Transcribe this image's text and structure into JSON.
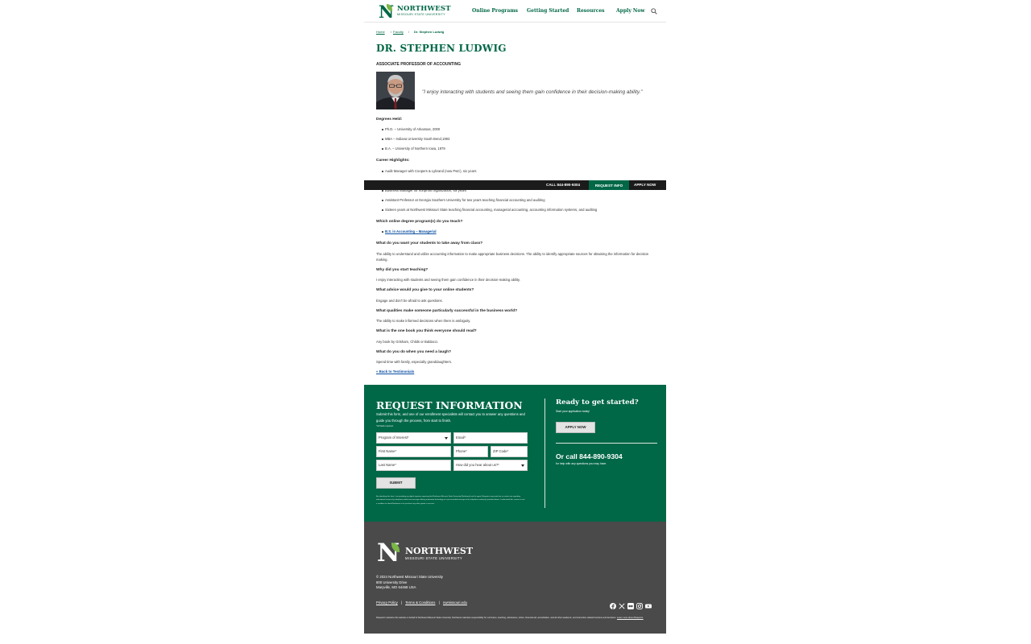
{
  "header": {
    "logo_title": "NORTHWEST",
    "logo_subtitle": "MISSOURI STATE UNIVERSITY",
    "nav": [
      "Online Programs",
      "Getting Started",
      "Resources",
      "Apply Now"
    ],
    "search_icon": "search-icon"
  },
  "breadcrumb": {
    "home": "Home",
    "sep": "/",
    "faculty": "Faculty",
    "current": "Dr. Stephen Ludwig"
  },
  "profile": {
    "name": "DR. STEPHEN LUDWIG",
    "title": "ASSOCIATE PROFESSOR OF ACCOUNTING",
    "quote": "\"I enjoy interacting with students and seeing them gain confidence in their decision-making ability.\""
  },
  "degrees": {
    "heading": "Degrees Held:",
    "items": [
      "Ph.D. – University of Arkansas, 2000",
      "MBA – Indiana University South Bend,1993",
      "B.A. – University of Northern Iowa, 1979"
    ]
  },
  "career": {
    "heading": "Career Highlights:",
    "items": [
      "Audit Manager with Coopers & Lybrand (now PwC), six years",
      "Business Manager for nonprofit organization, six years",
      "Assistant Professor at Georgia Southern University for two years teaching financial accounting and auditing",
      "Sixteen years at Northwest Missouri State teaching financial accounting, managerial accounting, accounting information systems, and auditing"
    ]
  },
  "qa": [
    {
      "q": "Which online degree program(s) do you teach?",
      "link": "B.S. in Accounting – Managerial"
    },
    {
      "q": "What do you want your students to take away from class?",
      "a": "The ability to understand and utilize accounting information to make appropriate business decisions. The ability to identify appropriate sources for obtaining the information for decision making."
    },
    {
      "q": "Why did you start teaching?",
      "a": "I enjoy interacting with students and seeing them gain confidence in their decision-making ability."
    },
    {
      "q": "What advice would you give to your online students?",
      "a": "Engage and don't be afraid to ask questions."
    },
    {
      "q": "What qualities make someone particularly successful in the business world?",
      "a": "The ability to make informed decisions when there is ambiguity."
    },
    {
      "q": "What is the one book you think everyone should read?",
      "a": "Any book by Grisham, Childs or Baldacci."
    },
    {
      "q": "What do you do when you need a laugh?",
      "a": "Spend time with family, especially granddaughters."
    }
  ],
  "back_link": "« Back to Testimonials",
  "sticky_bar": {
    "call": "CALL 844-890-9304",
    "request": "REQUEST INFO",
    "apply": "APPLY NOW"
  },
  "request_info": {
    "title": "REQUEST INFORMATION",
    "description": "Submit this form, and one of our enrollment specialists will contact you to answer any questions and guide you through the process, from start to finish.",
    "required_note": "*All fields required.",
    "fields": {
      "program": "Program of Interest*",
      "email": "Email*",
      "first_name": "First Name*",
      "phone": "Phone*",
      "zip": "ZIP Code*",
      "last_name": "Last Name*",
      "heard": "How did you hear about us?*"
    },
    "submit": "SUBMIT",
    "legal": "By submitting this form, I am providing my digital signature agreeing that Northwest Missouri State University (Northwest) and its agent, Risepoint, may email me or contact me regarding educational services by telephone and/or text message utilizing automated technology or a pre-recorded message at the telephone number(s) provided above. I understand this consent is not a condition to attend Northwest or to purchase any other goods or services.",
    "ready_title": "Ready to get started?",
    "ready_sub": "Start your application today!",
    "apply_btn": "APPLY NOW",
    "call_text": "Or call 844-890-9304",
    "call_sub": "for help with any questions you may have."
  },
  "footer": {
    "logo_title": "NORTHWEST",
    "logo_subtitle": "MISSOURI STATE UNIVERSITY",
    "copyright": "© 2024 Northwest Missouri State University",
    "address1": "800 University Drive",
    "address2": "Maryville, MO 64468 USA",
    "links": [
      "Privacy Policy",
      "Terms & Conditions",
      "nwmissouri.edu"
    ],
    "link_sep": "|",
    "social": [
      "facebook-icon",
      "x-icon",
      "flickr-icon",
      "instagram-icon",
      "youtube-icon"
    ],
    "legal": "Risepoint maintains this website on behalf of Northwest Missouri State University. Northwest maintains responsibility for curriculum, teaching, admissions, tuition, financial aid, accreditation, and all other academic- and instruction-related functions and decisions.",
    "legal_link": "Learn more about Risepoint."
  }
}
